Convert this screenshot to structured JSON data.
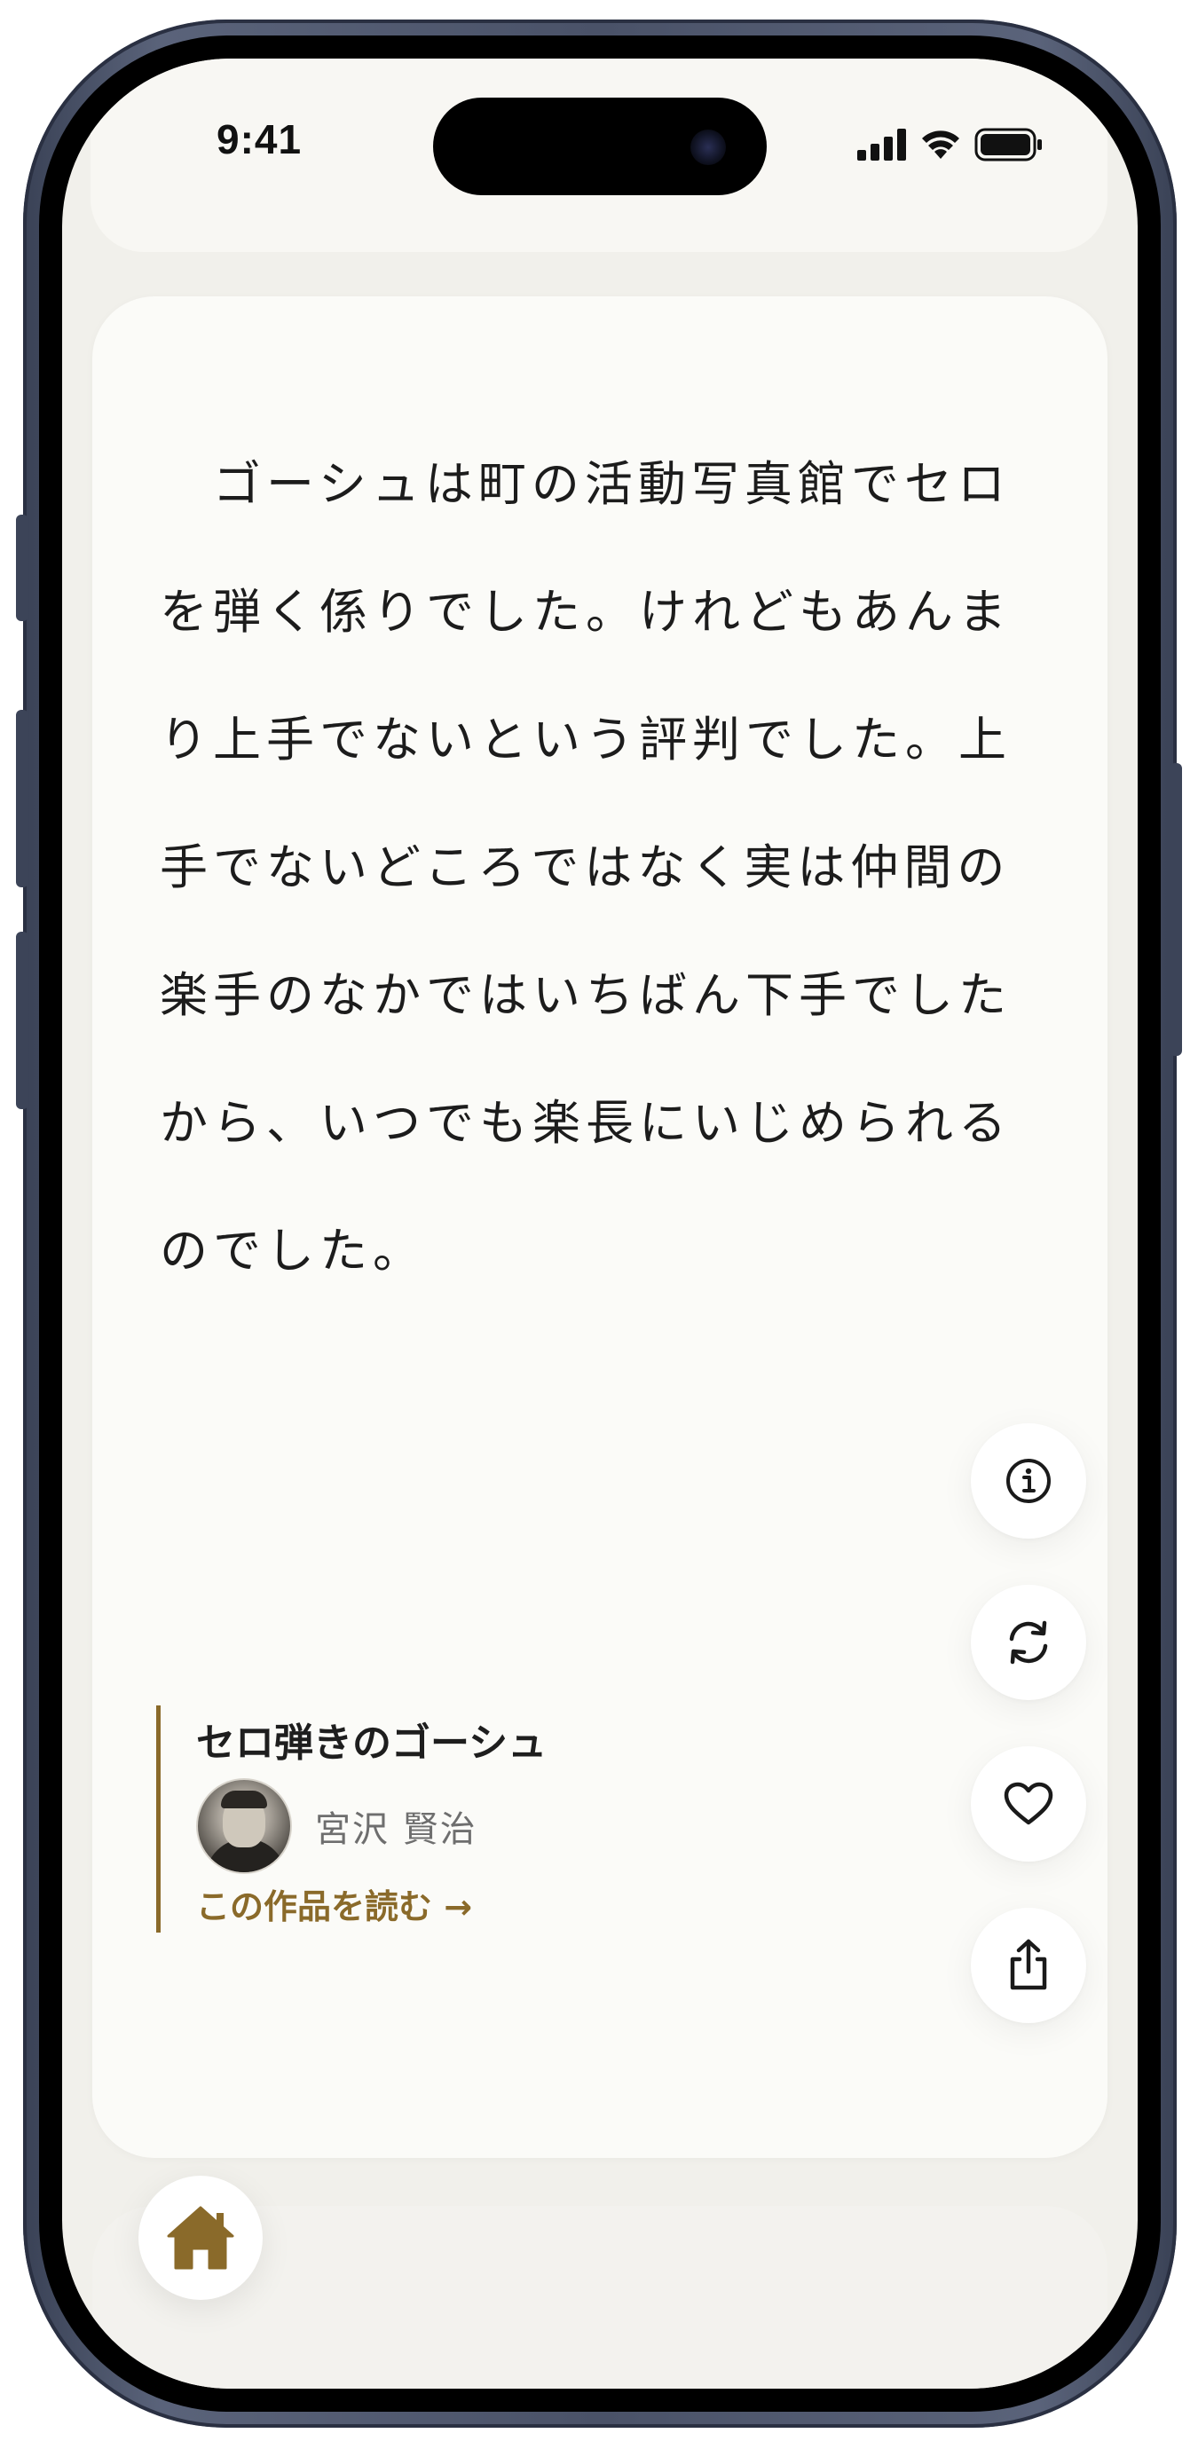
{
  "status_bar": {
    "time": "9:41"
  },
  "passage": {
    "text": "ゴーシュは町の活動写真館でセロを弾く係りでした。けれどもあんまり上手でないという評判でした。上手でないどころではなく実は仲間の楽手のなかではいちばん下手でしたから、いつでも楽長にいじめられるのでした。"
  },
  "work": {
    "title": "セロ弾きのゴーシュ",
    "author": "宮沢 賢治",
    "read_link": "この作品を読む →"
  },
  "actions": {
    "icons": [
      "info-icon",
      "refresh-icon",
      "heart-icon",
      "share-icon"
    ]
  },
  "nav": {
    "home_icon": "home-icon"
  },
  "colors": {
    "accent": "#8a6a2a",
    "background": "#f1f0eb",
    "card": "#fbfbf8",
    "text": "#1c1c1c"
  }
}
